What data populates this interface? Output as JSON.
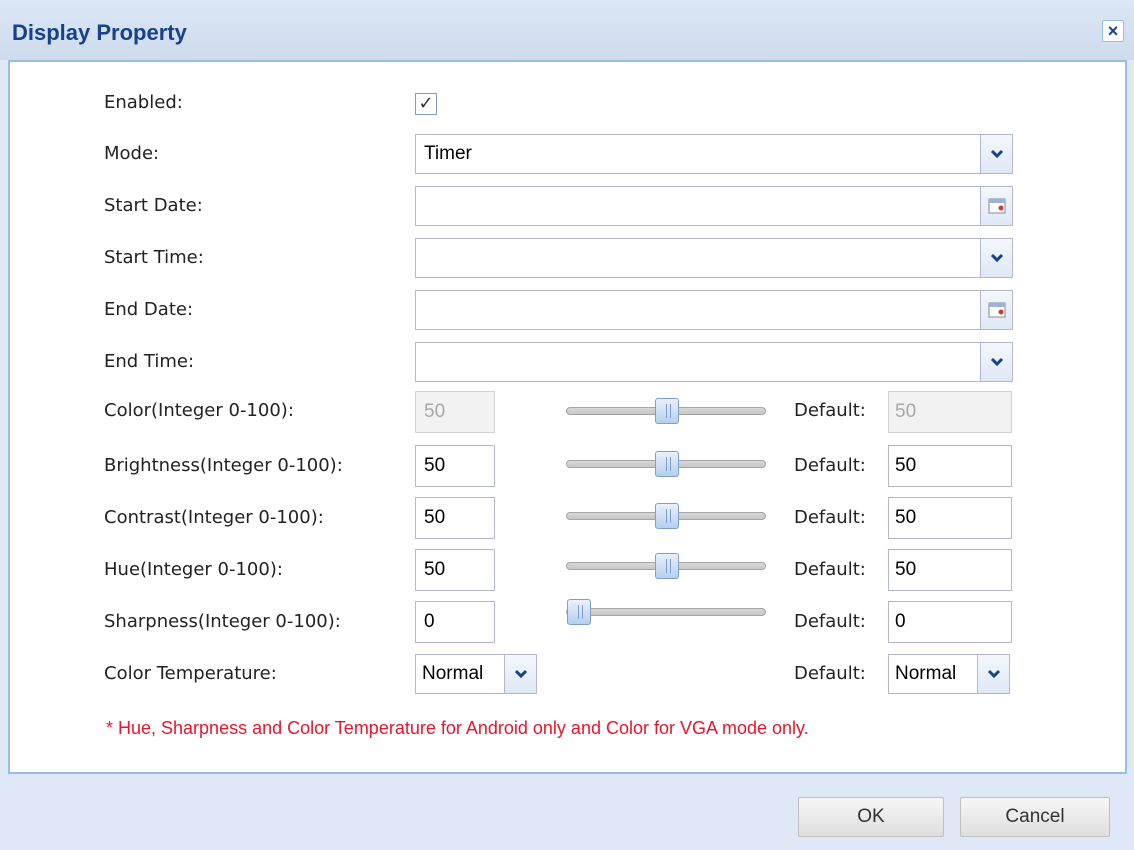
{
  "dialog": {
    "title": "Display Property",
    "close_label": "×"
  },
  "fields": {
    "enabled": {
      "label": "Enabled:",
      "checked": true,
      "check_glyph": "✓"
    },
    "mode": {
      "label": "Mode:",
      "value": "Timer"
    },
    "start_date": {
      "label": "Start Date:",
      "value": ""
    },
    "start_time": {
      "label": "Start Time:",
      "value": ""
    },
    "end_date": {
      "label": "End Date:",
      "value": ""
    },
    "end_time": {
      "label": "End Time:",
      "value": ""
    }
  },
  "adjustments": [
    {
      "label": "Color(Integer 0-100):",
      "value": "50",
      "slider_percent": 50,
      "default_label": "Default:",
      "default_value": "50",
      "disabled": true
    },
    {
      "label": "Brightness(Integer 0-100):",
      "value": "50",
      "slider_percent": 50,
      "default_label": "Default:",
      "default_value": "50",
      "disabled": false
    },
    {
      "label": "Contrast(Integer 0-100):",
      "value": "50",
      "slider_percent": 50,
      "default_label": "Default:",
      "default_value": "50",
      "disabled": false
    },
    {
      "label": "Hue(Integer 0-100):",
      "value": "50",
      "slider_percent": 50,
      "default_label": "Default:",
      "default_value": "50",
      "disabled": false
    },
    {
      "label": "Sharpness(Integer 0-100):",
      "value": "0",
      "slider_percent": 0,
      "default_label": "Default:",
      "default_value": "0",
      "disabled": false
    }
  ],
  "color_temperature": {
    "label": "Color Temperature:",
    "value": "Normal",
    "default_label": "Default:",
    "default_value": "Normal"
  },
  "note": "* Hue, Sharpness and Color Temperature for Android only and Color for VGA mode only.",
  "buttons": {
    "ok": "OK",
    "cancel": "Cancel"
  },
  "icons": {
    "dropdown": "chevron-down-icon",
    "date": "calendar-icon",
    "close": "close-icon"
  },
  "colors": {
    "title": "#15428b",
    "note": "#e8152c",
    "frame": "#dfe8f6"
  }
}
